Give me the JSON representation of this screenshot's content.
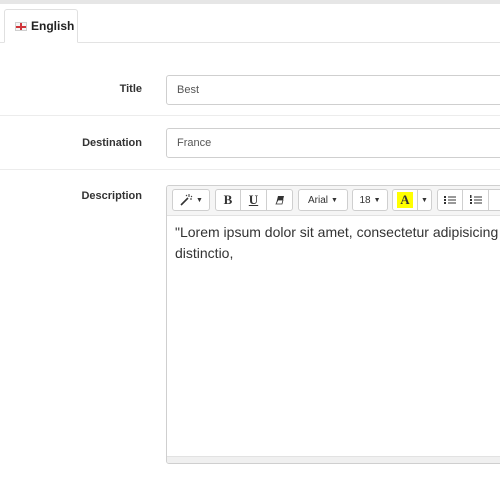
{
  "tabs": [
    {
      "label": "English",
      "flag": "english-flag-icon"
    }
  ],
  "form": {
    "title": {
      "label": "Title",
      "value": "Best"
    },
    "destination": {
      "label": "Destination",
      "value": "France"
    },
    "description": {
      "label": "Description",
      "toolbar": {
        "font_family": "Arial",
        "font_size": "18",
        "bold": "B",
        "underline": "U",
        "highlight": "A",
        "highlight_color": "#ffff00"
      },
      "content_line1": "\"Lorem ipsum dolor sit amet, consectetur adipisicing",
      "content_line2": "distinctio,"
    }
  }
}
